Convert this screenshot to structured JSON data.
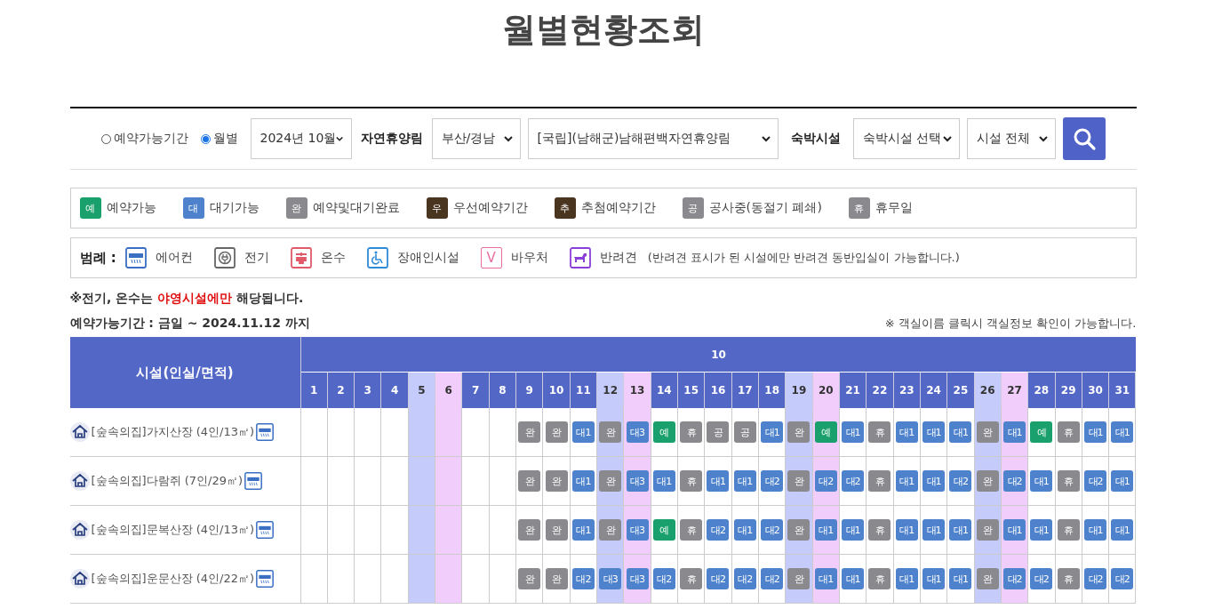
{
  "title": "월별현황조회",
  "filters": {
    "period_options": [
      {
        "label": "예약가능기간",
        "selected": false
      },
      {
        "label": "월별",
        "selected": true
      }
    ],
    "month": "2024년 10월",
    "forest_label": "자연휴양림",
    "region": "부산/경남",
    "forest": "[국립](남해군)남해편백자연휴양림",
    "lodging_label": "숙박시설",
    "lodging": "숙박시설 선택",
    "facility": "시설 전체"
  },
  "status_legend": [
    {
      "badge": "예",
      "label": "예약가능",
      "kind": "available"
    },
    {
      "badge": "대",
      "label": "대기가능",
      "kind": "waiting"
    },
    {
      "badge": "완",
      "label": "예약및대기완료",
      "kind": "closed"
    },
    {
      "badge": "우",
      "label": "우선예약기간",
      "kind": "priority"
    },
    {
      "badge": "추",
      "label": "추첨예약기간",
      "kind": "lottery"
    },
    {
      "badge": "공",
      "label": "공사중(동절기 폐쇄)",
      "kind": "closed"
    },
    {
      "badge": "휴",
      "label": "휴무일",
      "kind": "closed"
    }
  ],
  "amenity_legend": {
    "title": "범례 :",
    "items": [
      {
        "label": "에어컨",
        "kind": "aircon"
      },
      {
        "label": "전기",
        "kind": "power"
      },
      {
        "label": "온수",
        "kind": "hotwater"
      },
      {
        "label": "장애인시설",
        "kind": "accessible"
      },
      {
        "label": "바우처",
        "kind": "voucher",
        "letter": "V"
      },
      {
        "label": "반려견",
        "kind": "pet"
      }
    ],
    "note": "(반려견 표시가 된 시설에만 반려견 동반입실이 가능합니다.)"
  },
  "notice": "※전기, 온수는 **야영시설에만** 해당됩니다.",
  "period": "예약가능기간 : 금일 ~ 2024.11.12 까지",
  "hint": "※ 객실이름 클릭시 객실정보 확인이 가능합니다.",
  "table": {
    "facility_header": "시설(인실/면적)",
    "month": "10",
    "days": [
      {
        "label": "1",
        "kind": "weekday"
      },
      {
        "label": "2",
        "kind": "weekday"
      },
      {
        "label": "3",
        "kind": "weekday"
      },
      {
        "label": "4",
        "kind": "weekday"
      },
      {
        "label": "5",
        "kind": "saturday"
      },
      {
        "label": "6",
        "kind": "sunday"
      },
      {
        "label": "7",
        "kind": "weekday"
      },
      {
        "label": "8",
        "kind": "weekday"
      },
      {
        "label": "9",
        "kind": "weekday"
      },
      {
        "label": "10",
        "kind": "weekday"
      },
      {
        "label": "11",
        "kind": "weekday"
      },
      {
        "label": "12",
        "kind": "saturday"
      },
      {
        "label": "13",
        "kind": "sunday"
      },
      {
        "label": "14",
        "kind": "weekday"
      },
      {
        "label": "15",
        "kind": "weekday"
      },
      {
        "label": "16",
        "kind": "weekday"
      },
      {
        "label": "17",
        "kind": "weekday"
      },
      {
        "label": "18",
        "kind": "weekday"
      },
      {
        "label": "19",
        "kind": "saturday"
      },
      {
        "label": "20",
        "kind": "sunday"
      },
      {
        "label": "21",
        "kind": "weekday"
      },
      {
        "label": "22",
        "kind": "weekday"
      },
      {
        "label": "23",
        "kind": "weekday"
      },
      {
        "label": "24",
        "kind": "weekday"
      },
      {
        "label": "25",
        "kind": "weekday"
      },
      {
        "label": "26",
        "kind": "saturday"
      },
      {
        "label": "27",
        "kind": "sunday"
      },
      {
        "label": "28",
        "kind": "weekday"
      },
      {
        "label": "29",
        "kind": "weekday"
      },
      {
        "label": "30",
        "kind": "weekday"
      },
      {
        "label": "31",
        "kind": "weekday"
      }
    ],
    "rows": [
      {
        "name": "[숲속의집]가지산장 (4인/13㎡)",
        "cells": [
          {
            "kind": "empty"
          },
          {
            "kind": "empty"
          },
          {
            "kind": "empty"
          },
          {
            "kind": "empty"
          },
          {
            "kind": "empty"
          },
          {
            "kind": "empty"
          },
          {
            "kind": "empty"
          },
          {
            "kind": "empty"
          },
          {
            "text": "완",
            "kind": "closed"
          },
          {
            "text": "완",
            "kind": "closed"
          },
          {
            "text": "대1",
            "kind": "waiting"
          },
          {
            "text": "완",
            "kind": "closed"
          },
          {
            "text": "대3",
            "kind": "waiting"
          },
          {
            "text": "예",
            "kind": "available"
          },
          {
            "text": "휴",
            "kind": "closed"
          },
          {
            "text": "공",
            "kind": "closed"
          },
          {
            "text": "공",
            "kind": "closed"
          },
          {
            "text": "대1",
            "kind": "waiting"
          },
          {
            "text": "완",
            "kind": "closed"
          },
          {
            "text": "예",
            "kind": "available"
          },
          {
            "text": "대1",
            "kind": "waiting"
          },
          {
            "text": "휴",
            "kind": "closed"
          },
          {
            "text": "대1",
            "kind": "waiting"
          },
          {
            "text": "대1",
            "kind": "waiting"
          },
          {
            "text": "대1",
            "kind": "waiting"
          },
          {
            "text": "완",
            "kind": "closed"
          },
          {
            "text": "대1",
            "kind": "waiting"
          },
          {
            "text": "예",
            "kind": "available"
          },
          {
            "text": "휴",
            "kind": "closed"
          },
          {
            "text": "대1",
            "kind": "waiting"
          },
          {
            "text": "대1",
            "kind": "waiting"
          }
        ]
      },
      {
        "name": "[숲속의집]다람쥐 (7인/29㎡)",
        "cells": [
          {
            "kind": "empty"
          },
          {
            "kind": "empty"
          },
          {
            "kind": "empty"
          },
          {
            "kind": "empty"
          },
          {
            "kind": "empty"
          },
          {
            "kind": "empty"
          },
          {
            "kind": "empty"
          },
          {
            "kind": "empty"
          },
          {
            "text": "완",
            "kind": "closed"
          },
          {
            "text": "완",
            "kind": "closed"
          },
          {
            "text": "대1",
            "kind": "waiting"
          },
          {
            "text": "완",
            "kind": "closed"
          },
          {
            "text": "대3",
            "kind": "waiting"
          },
          {
            "text": "대1",
            "kind": "waiting"
          },
          {
            "text": "휴",
            "kind": "closed"
          },
          {
            "text": "대1",
            "kind": "waiting"
          },
          {
            "text": "대1",
            "kind": "waiting"
          },
          {
            "text": "대2",
            "kind": "waiting"
          },
          {
            "text": "완",
            "kind": "closed"
          },
          {
            "text": "대2",
            "kind": "waiting"
          },
          {
            "text": "대2",
            "kind": "waiting"
          },
          {
            "text": "휴",
            "kind": "closed"
          },
          {
            "text": "대1",
            "kind": "waiting"
          },
          {
            "text": "대1",
            "kind": "waiting"
          },
          {
            "text": "대2",
            "kind": "waiting"
          },
          {
            "text": "완",
            "kind": "closed"
          },
          {
            "text": "대2",
            "kind": "waiting"
          },
          {
            "text": "대1",
            "kind": "waiting"
          },
          {
            "text": "휴",
            "kind": "closed"
          },
          {
            "text": "대2",
            "kind": "waiting"
          },
          {
            "text": "대1",
            "kind": "waiting"
          }
        ]
      },
      {
        "name": "[숲속의집]문복산장 (4인/13㎡)",
        "cells": [
          {
            "kind": "empty"
          },
          {
            "kind": "empty"
          },
          {
            "kind": "empty"
          },
          {
            "kind": "empty"
          },
          {
            "kind": "empty"
          },
          {
            "kind": "empty"
          },
          {
            "kind": "empty"
          },
          {
            "kind": "empty"
          },
          {
            "text": "완",
            "kind": "closed"
          },
          {
            "text": "완",
            "kind": "closed"
          },
          {
            "text": "대1",
            "kind": "waiting"
          },
          {
            "text": "완",
            "kind": "closed"
          },
          {
            "text": "대3",
            "kind": "waiting"
          },
          {
            "text": "예",
            "kind": "available"
          },
          {
            "text": "휴",
            "kind": "closed"
          },
          {
            "text": "대2",
            "kind": "waiting"
          },
          {
            "text": "대1",
            "kind": "waiting"
          },
          {
            "text": "대2",
            "kind": "waiting"
          },
          {
            "text": "완",
            "kind": "closed"
          },
          {
            "text": "대1",
            "kind": "waiting"
          },
          {
            "text": "대1",
            "kind": "waiting"
          },
          {
            "text": "휴",
            "kind": "closed"
          },
          {
            "text": "대1",
            "kind": "waiting"
          },
          {
            "text": "대1",
            "kind": "waiting"
          },
          {
            "text": "대1",
            "kind": "waiting"
          },
          {
            "text": "완",
            "kind": "closed"
          },
          {
            "text": "대1",
            "kind": "waiting"
          },
          {
            "text": "대1",
            "kind": "waiting"
          },
          {
            "text": "휴",
            "kind": "closed"
          },
          {
            "text": "대1",
            "kind": "waiting"
          },
          {
            "text": "대1",
            "kind": "waiting"
          }
        ]
      },
      {
        "name": "[숲속의집]운문산장 (4인/22㎡)",
        "cells": [
          {
            "kind": "empty"
          },
          {
            "kind": "empty"
          },
          {
            "kind": "empty"
          },
          {
            "kind": "empty"
          },
          {
            "kind": "empty"
          },
          {
            "kind": "empty"
          },
          {
            "kind": "empty"
          },
          {
            "kind": "empty"
          },
          {
            "text": "완",
            "kind": "closed"
          },
          {
            "text": "완",
            "kind": "closed"
          },
          {
            "text": "대2",
            "kind": "waiting"
          },
          {
            "text": "대3",
            "kind": "waiting"
          },
          {
            "text": "대3",
            "kind": "waiting"
          },
          {
            "text": "대2",
            "kind": "waiting"
          },
          {
            "text": "휴",
            "kind": "closed"
          },
          {
            "text": "대2",
            "kind": "waiting"
          },
          {
            "text": "대2",
            "kind": "waiting"
          },
          {
            "text": "대2",
            "kind": "waiting"
          },
          {
            "text": "완",
            "kind": "closed"
          },
          {
            "text": "대1",
            "kind": "waiting"
          },
          {
            "text": "대1",
            "kind": "waiting"
          },
          {
            "text": "휴",
            "kind": "closed"
          },
          {
            "text": "대1",
            "kind": "waiting"
          },
          {
            "text": "대1",
            "kind": "waiting"
          },
          {
            "text": "대1",
            "kind": "waiting"
          },
          {
            "text": "완",
            "kind": "closed"
          },
          {
            "text": "대2",
            "kind": "waiting"
          },
          {
            "text": "대2",
            "kind": "waiting"
          },
          {
            "text": "휴",
            "kind": "closed"
          },
          {
            "text": "대2",
            "kind": "waiting"
          },
          {
            "text": "대2",
            "kind": "waiting"
          }
        ]
      }
    ]
  }
}
